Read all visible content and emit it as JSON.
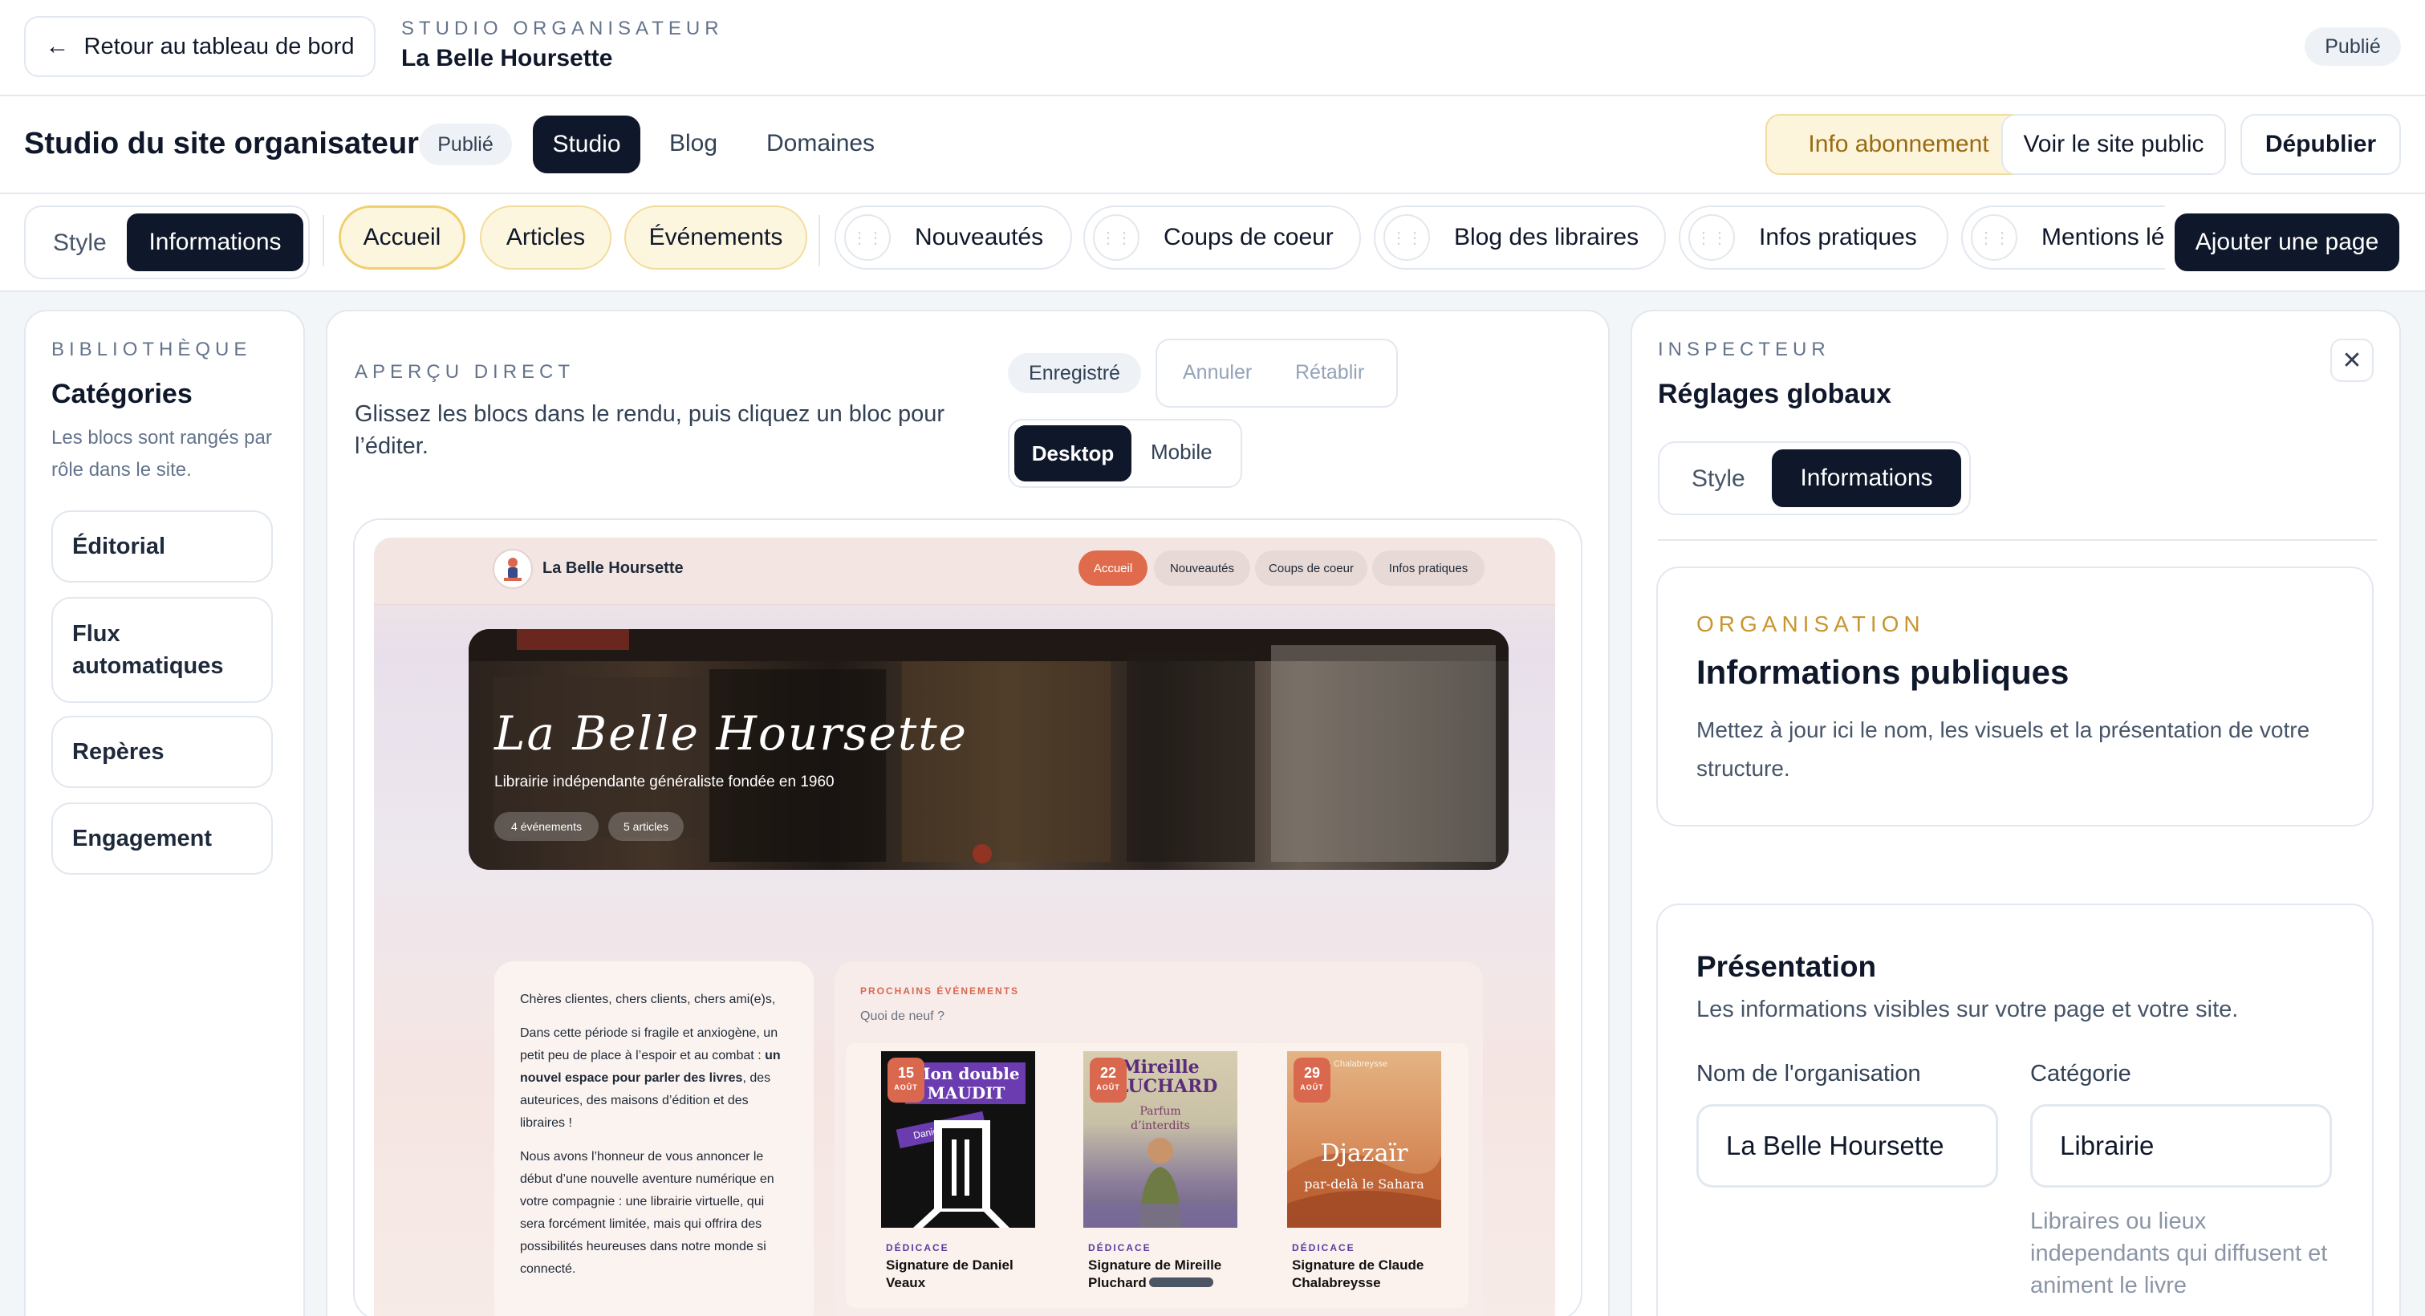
{
  "topbar": {
    "back_label": "Retour au tableau de bord",
    "studio_kicker": "STUDIO ORGANISATEUR",
    "site_name": "La Belle Hoursette",
    "status": "Publié"
  },
  "header": {
    "title": "Studio du site organisateur",
    "status": "Publié",
    "tabs": [
      {
        "label": "Studio",
        "active": true
      },
      {
        "label": "Blog",
        "active": false
      },
      {
        "label": "Domaines",
        "active": false
      }
    ],
    "subscription_label": "Info abonnement",
    "view_public_label": "Voir le site public",
    "unpublish_label": "Dépublier"
  },
  "page_toolbar": {
    "mode_tabs": [
      {
        "label": "Style",
        "active": false
      },
      {
        "label": "Informations",
        "active": true
      }
    ],
    "pages": [
      {
        "label": "Accueil",
        "kind": "fixed"
      },
      {
        "label": "Articles",
        "kind": "fixed"
      },
      {
        "label": "Événements",
        "kind": "fixed"
      },
      {
        "label": "Nouveautés",
        "kind": "draggable"
      },
      {
        "label": "Coups de coeur",
        "kind": "draggable"
      },
      {
        "label": "Blog des libraires",
        "kind": "draggable"
      },
      {
        "label": "Infos pratiques",
        "kind": "draggable"
      },
      {
        "label": "Mentions lé",
        "kind": "draggable"
      }
    ],
    "add_page_label": "Ajouter une page"
  },
  "library": {
    "kicker": "BIBLIOTHÈQUE",
    "title": "Catégories",
    "description": "Les blocs sont rangés par rôle dans le site.",
    "categories": [
      "Éditorial",
      "Flux automatiques",
      "Repères",
      "Engagement"
    ]
  },
  "preview": {
    "kicker": "APERÇU DIRECT",
    "instructions": "Glissez les blocs dans le rendu, puis cliquez un bloc pour l’éditer.",
    "saved_label": "Enregistré",
    "undo_label": "Annuler",
    "redo_label": "Rétablir",
    "device_tabs": [
      {
        "label": "Desktop",
        "active": true
      },
      {
        "label": "Mobile",
        "active": false
      }
    ],
    "site": {
      "brand": "La Belle Hoursette",
      "nav": [
        "Accueil",
        "Nouveautés",
        "Coups de coeur",
        "Infos pratiques"
      ],
      "hero_title": "La Belle Hoursette",
      "hero_subtitle": "Librairie indépendante généraliste fondée en 1960",
      "hero_badges": [
        "4 événements",
        "5 articles"
      ],
      "letter": {
        "greeting": "Chères clientes, chers clients, chers ami(e)s,",
        "p1_before": "Dans cette période si fragile et anxiogène, un petit peu de place à l’espoir et au combat : ",
        "p1_bold": "un nouvel espace pour parler des livres",
        "p1_after": ", des auteurices, des maisons d’édition et des libraires !",
        "p2": "Nous avons l’honneur de vous annoncer le début d’une nouvelle aventure numérique en votre compagnie : une librairie virtuelle, qui sera forcément limitée, mais qui offrira des possibilités heureuses dans notre monde si connecté."
      },
      "events_kicker": "PROCHAINS ÉVÉNEMENTS",
      "events_subtitle": "Quoi de neuf ?",
      "events": [
        {
          "day": "15",
          "month": "AOÛT",
          "tag": "DÉDICACE",
          "title": "Signature de Daniel Veaux",
          "cover_title": "Mon double MAUDIT",
          "cover_author": "Daniel Veaux"
        },
        {
          "day": "22",
          "month": "AOÛT",
          "tag": "DÉDICACE",
          "title": "Signature de Mireille Pluchard",
          "cover_title": "Mireille PLUCHARD",
          "cover_subtitle": "Parfum d’interdits"
        },
        {
          "day": "29",
          "month": "AOÛT",
          "tag": "DÉDICACE",
          "title": "Signature de Claude Chalabreysse",
          "cover_title": "Djazaïr",
          "cover_subtitle": "par-delà le Sahara",
          "cover_author": "Claude Chalabreysse"
        }
      ]
    }
  },
  "inspector": {
    "kicker": "INSPECTEUR",
    "title": "Réglages globaux",
    "tabs": [
      {
        "label": "Style",
        "active": false
      },
      {
        "label": "Informations",
        "active": true
      }
    ],
    "org_card": {
      "kicker": "ORGANISATION",
      "title": "Informations publiques",
      "description": "Mettez à jour ici le nom, les visuels et la présentation de votre structure."
    },
    "presentation": {
      "title": "Présentation",
      "description": "Les informations visibles sur votre page et votre site.",
      "name_label": "Nom de l'organisation",
      "name_value": "La Belle Hoursette",
      "category_label": "Catégorie",
      "category_value": "Librairie",
      "category_help": "Libraires ou lieux independants qui diffusent et animent le livre"
    }
  },
  "colors": {
    "dark": "#0f172a",
    "accent_gold": "#c9952f",
    "subscription_bg": "#fdf4dc",
    "preview_accent": "#e06b4c",
    "page_bg": "#f3f6f9"
  }
}
